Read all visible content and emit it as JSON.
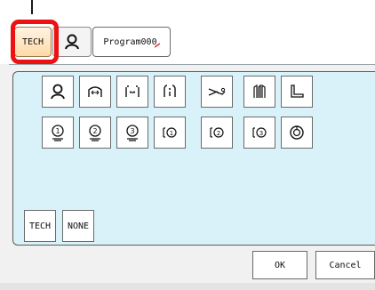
{
  "tabs": [
    {
      "label": "TECH",
      "icon": "tech-tab",
      "selected": true
    },
    {
      "icon": "person-icon"
    },
    {
      "label": "Program000",
      "accent_mark_color": "#e0303a"
    }
  ],
  "icon_buttons_row1": [
    "person-icon",
    "full-arch-icon",
    "spread-arch-icon",
    "adjust-arch-icon",
    "slide-icon",
    "pillars-icon",
    "corner-icon"
  ],
  "icon_buttons_row2": [
    "arch-1-icon",
    "arch-2-icon",
    "arch-3-icon",
    "panel-1-icon",
    "panel-2-icon",
    "panel-3-icon",
    "ring-icon"
  ],
  "mode_buttons": {
    "tech": "TECH",
    "none": "NONE"
  },
  "dialog_buttons": {
    "ok": "OK",
    "cancel": "Cancel"
  },
  "colors": {
    "highlight": "#ee1111",
    "tab_selected": "#ffd9a6",
    "content_bg": "#d9f2fa"
  }
}
